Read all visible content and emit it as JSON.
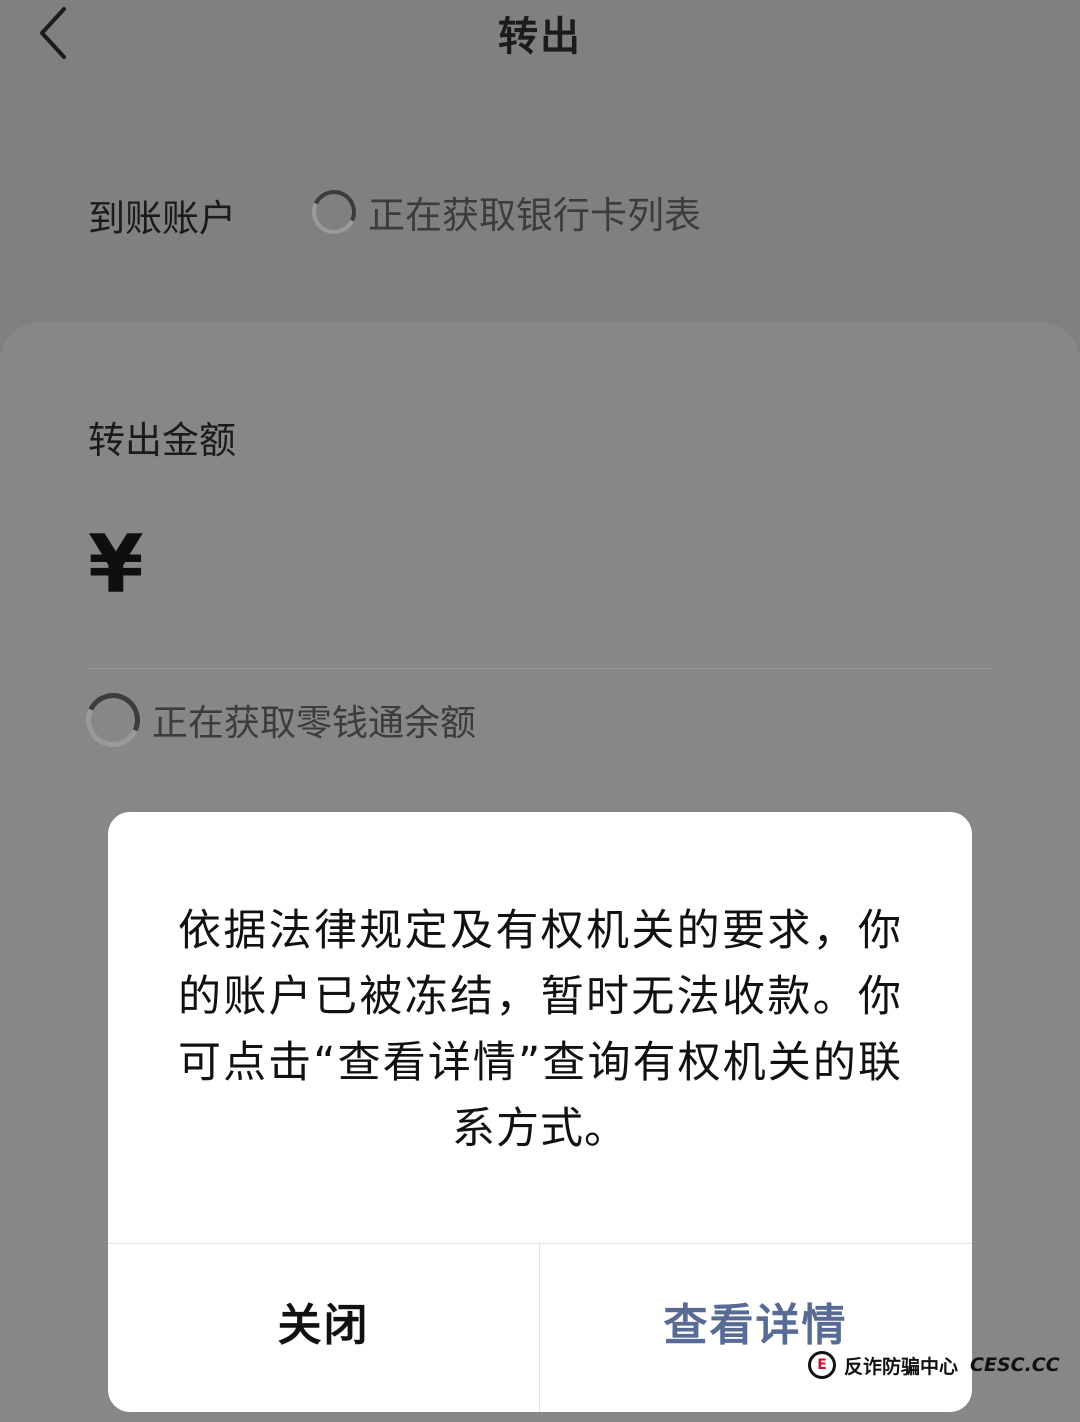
{
  "header": {
    "title": "转出",
    "back_icon": "chevron-left-icon"
  },
  "account": {
    "label": "到账账户",
    "loading_text": "正在获取银行卡列表"
  },
  "amount": {
    "label": "转出金额",
    "currency_symbol": "¥",
    "balance_loading_text": "正在获取零钱通余额"
  },
  "dialog": {
    "message": "依据法律规定及有权机关的要求，你的账户已被冻结，暂时无法收款。你可点击“查看详情”查询有权机关的联系方式。",
    "close_label": "关闭",
    "details_label": "查看详情"
  },
  "watermark": {
    "logo_text": "E",
    "name": "反诈防骗中心",
    "site": "CESC.CC"
  },
  "colors": {
    "overlay_bg": "#808080",
    "dialog_bg": "#ffffff",
    "link_blue": "#576b95",
    "text_primary": "#111111"
  }
}
